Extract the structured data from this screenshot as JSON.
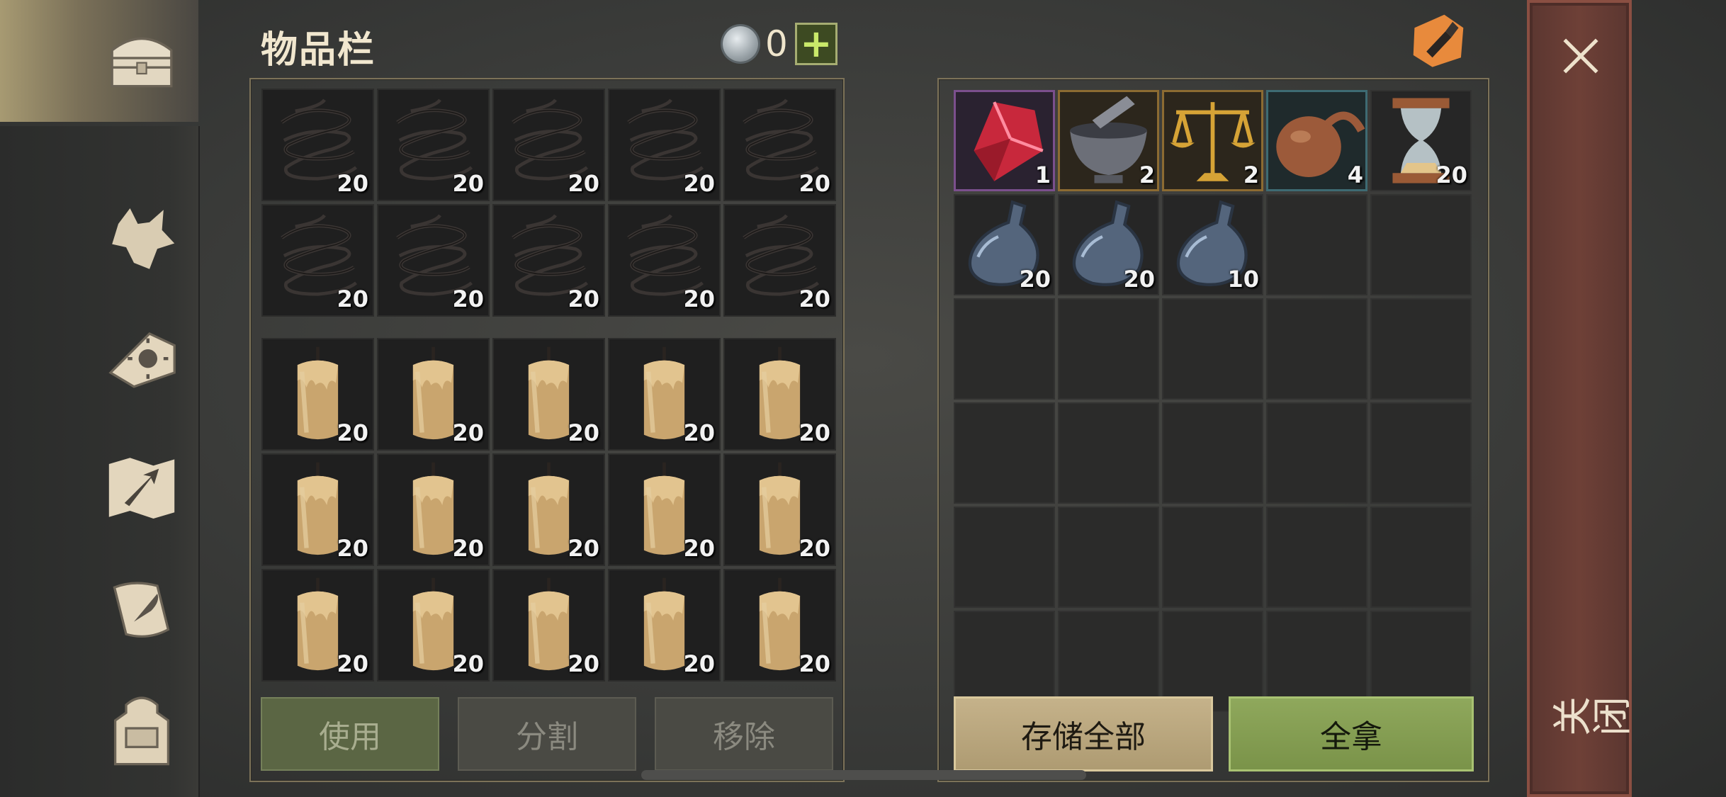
{
  "inventory": {
    "title": "物品栏",
    "currency_value": "0",
    "plus_label": "+",
    "wire_counts": [
      "20",
      "20",
      "20",
      "20",
      "20",
      "20",
      "20",
      "20",
      "20",
      "20"
    ],
    "candle_counts": [
      "20",
      "20",
      "20",
      "20",
      "20",
      "20",
      "20",
      "20",
      "20",
      "20",
      "20",
      "20",
      "20",
      "20",
      "20"
    ],
    "buttons": {
      "use": "使用",
      "split": "分割",
      "remove": "移除"
    }
  },
  "storage": {
    "row1": [
      {
        "icon": "red-crystal-icon",
        "count": "1",
        "rarity": "purple"
      },
      {
        "icon": "mortar-icon",
        "count": "2",
        "rarity": "gold"
      },
      {
        "icon": "scales-icon",
        "count": "2",
        "rarity": "gold"
      },
      {
        "icon": "gourd-retort-icon",
        "count": "4",
        "rarity": "teal"
      },
      {
        "icon": "hourglass-icon",
        "count": "20",
        "rarity": "none"
      }
    ],
    "row2": [
      {
        "icon": "flask-icon",
        "count": "20"
      },
      {
        "icon": "flask-icon",
        "count": "20"
      },
      {
        "icon": "flask-icon",
        "count": "10"
      }
    ],
    "buttons": {
      "store_all": "存储全部",
      "take_all": "全拿"
    }
  },
  "close": {
    "label": "关闭"
  },
  "colors": {
    "accent_gold": "#c5b28a",
    "accent_green": "#8fa85c",
    "close_red": "#6e4037"
  },
  "nav_icons": [
    "chest-icon",
    "wolf-icon",
    "sun-book-icon",
    "map-arrow-icon",
    "scroll-quill-icon",
    "backpack-icon"
  ]
}
